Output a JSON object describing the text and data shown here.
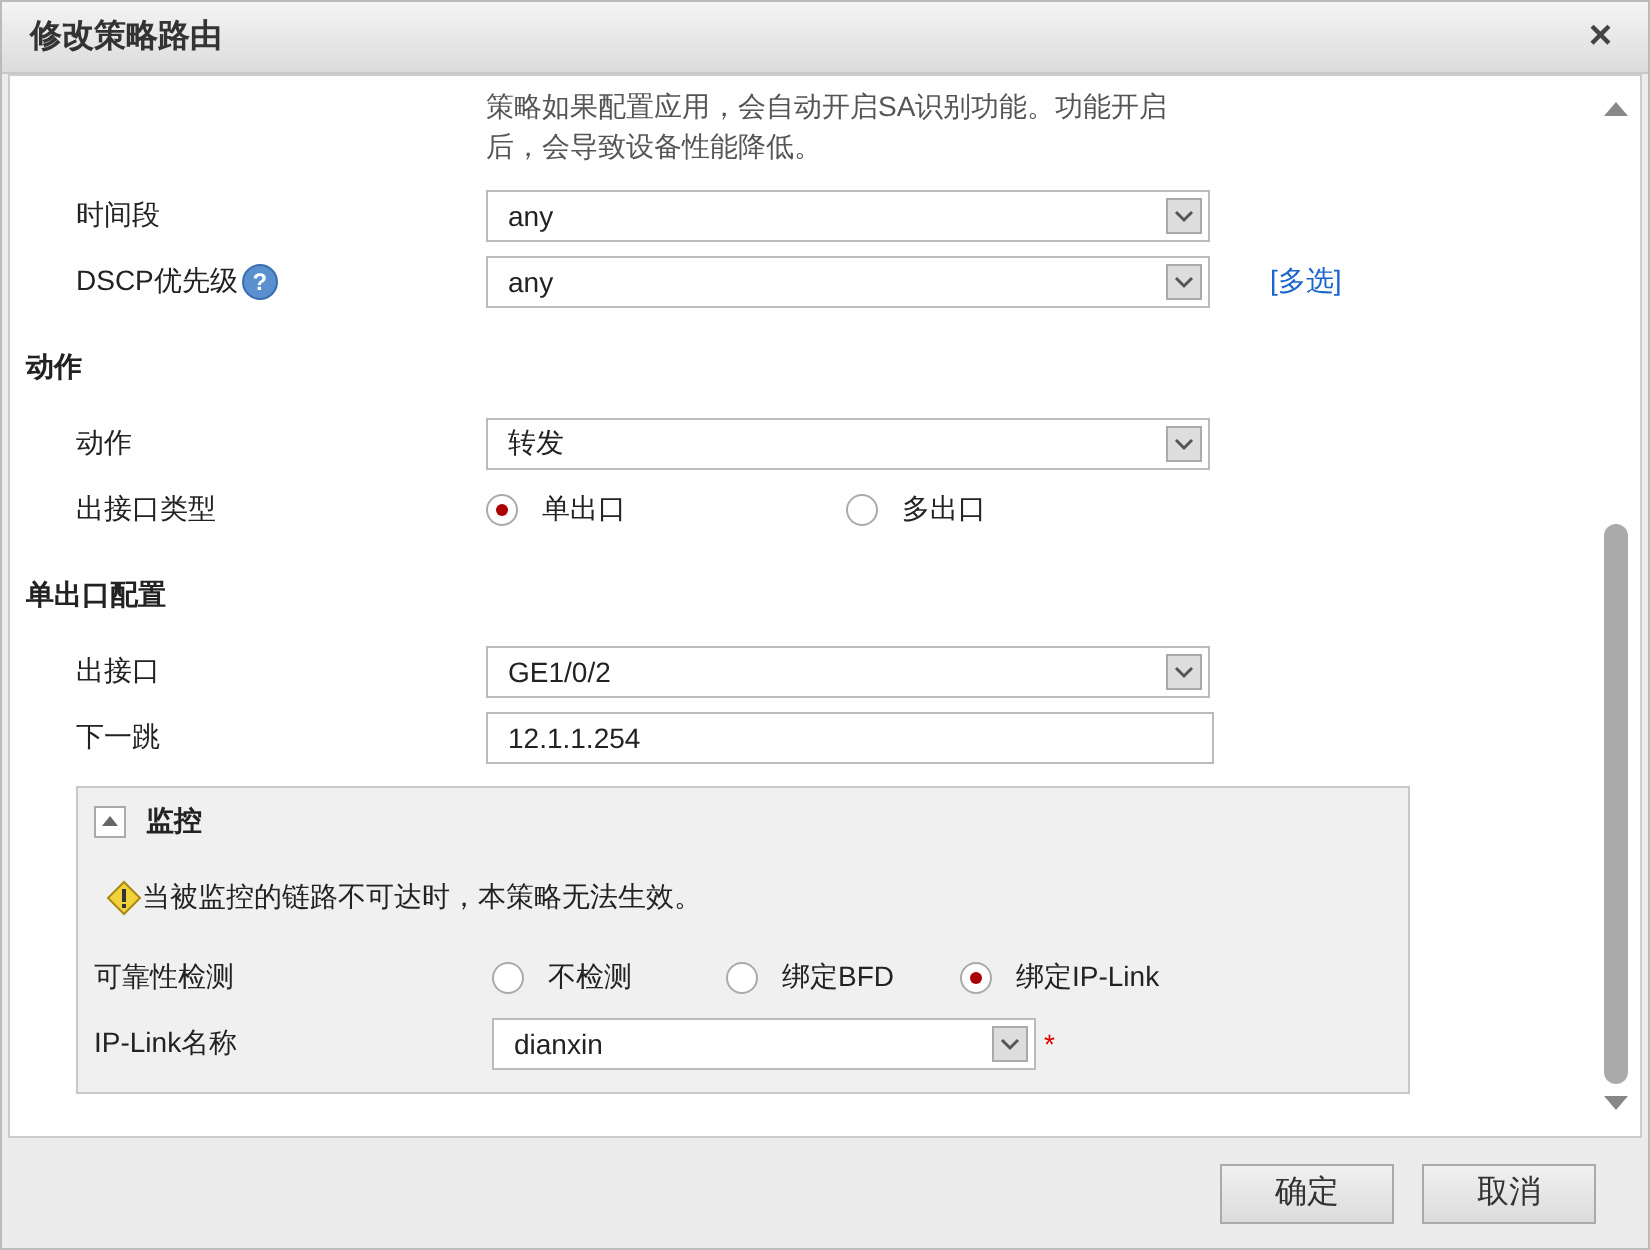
{
  "window": {
    "title": "修改策略路由",
    "close": "×"
  },
  "form": [
    {
      "kind": "note",
      "text": "策略如果配置应用，会自动开启SA识别功能。功能开启后，会导致设备性能降低。"
    },
    {
      "kind": "select",
      "label": "时间段",
      "value": "any"
    },
    {
      "kind": "select",
      "label": "DSCP优先级",
      "help": "?",
      "value": "any",
      "link": "[多选]"
    },
    {
      "kind": "heading",
      "text": "动作"
    },
    {
      "kind": "select",
      "label": "动作",
      "value": "转发"
    },
    {
      "kind": "radio",
      "label": "出接口类型",
      "options": [
        {
          "label": "单出口",
          "selected": true
        },
        {
          "label": "多出口",
          "selected": false
        }
      ]
    },
    {
      "kind": "heading",
      "text": "单出口配置"
    },
    {
      "kind": "select",
      "label": "出接口",
      "value": "GE1/0/2"
    },
    {
      "kind": "input",
      "label": "下一跳",
      "value": "12.1.1.254"
    },
    {
      "kind": "panel",
      "title": "监控",
      "expanded": true,
      "items": [
        {
          "kind": "warning",
          "text": "当被监控的链路不可达时，本策略无法生效。"
        },
        {
          "kind": "radio",
          "label": "可靠性检测",
          "options": [
            {
              "label": "不检测",
              "selected": false
            },
            {
              "label": "绑定BFD",
              "selected": false
            },
            {
              "label": "绑定IP-Link",
              "selected": true
            }
          ]
        },
        {
          "kind": "select",
          "label": "IP-Link名称",
          "value": "dianxin",
          "required_mark": "*"
        }
      ]
    }
  ],
  "buttons": [
    "确定",
    "取消"
  ]
}
